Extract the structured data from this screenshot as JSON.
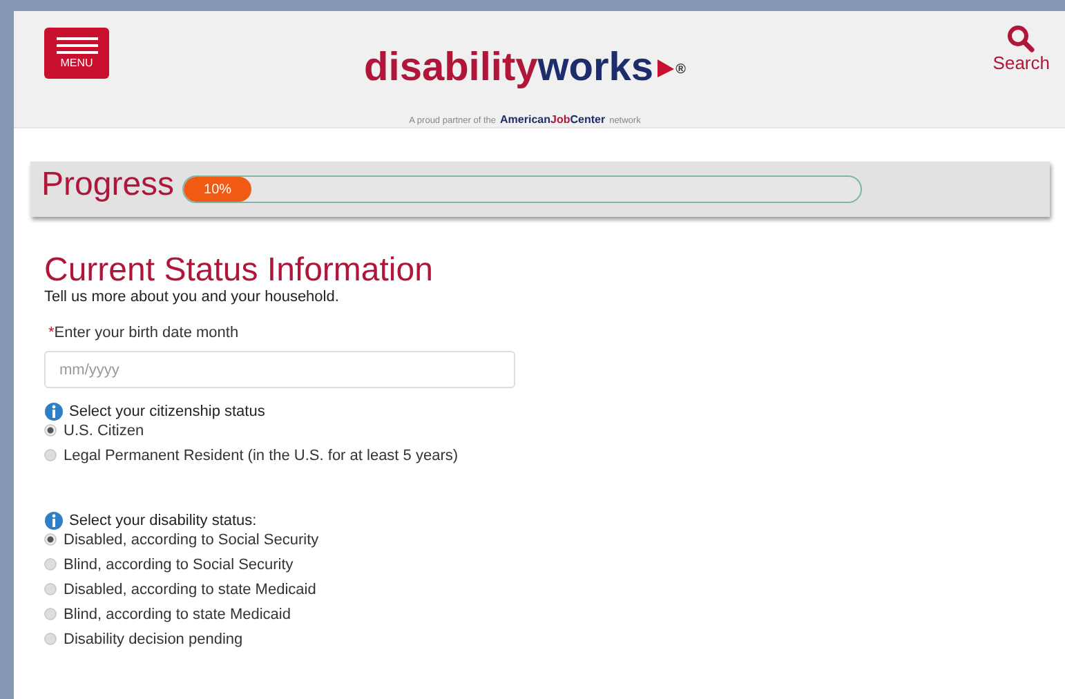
{
  "header": {
    "menu_label": "MENU",
    "logo": {
      "part_1": "disability",
      "part_2": "works",
      "mark": "®"
    },
    "partner": {
      "prefix": "A proud partner of the",
      "brand_1": "American",
      "brand_2": "Job",
      "brand_3": "Center",
      "suffix": "network"
    },
    "search_label": "Search"
  },
  "progress": {
    "title": "Progress",
    "level": 0.1,
    "reading": "10%"
  },
  "form": {
    "title": "Current Status Information",
    "subtitle": "Tell us more about you and your household.",
    "birth": {
      "required_mark": "*",
      "label": "Enter your birth date month",
      "placeholder": "mm/yyyy"
    },
    "groups": [
      {
        "label": "Select your citizenship status",
        "options": [
          {
            "label": "U.S. Citizen",
            "selected": true
          },
          {
            "label": "Legal Permanent Resident (in the U.S. for at least 5 years)",
            "selected": false
          }
        ]
      },
      {
        "label": "Select your disability status:",
        "options": [
          {
            "label": "Disabled, according to Social Security",
            "selected": true
          },
          {
            "label": "Blind, according to Social Security",
            "selected": false
          },
          {
            "label": "Disabled, according to state Medicaid",
            "selected": false
          },
          {
            "label": "Blind, according to state Medicaid",
            "selected": false
          },
          {
            "label": "Disability decision pending",
            "selected": false
          }
        ]
      }
    ]
  }
}
